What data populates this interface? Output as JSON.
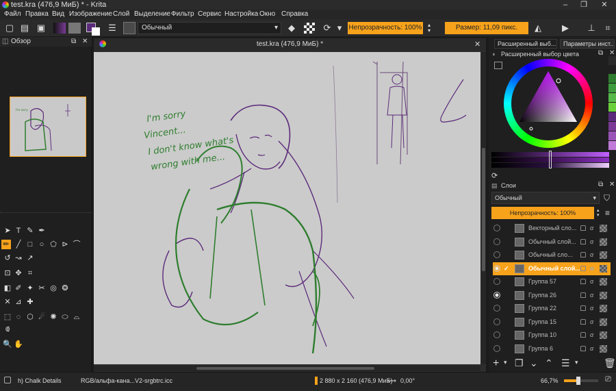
{
  "window": {
    "title": "test.kra (476,9 МиБ) * - Krita"
  },
  "menu": [
    "Файл",
    "Правка",
    "Вид",
    "Изображение",
    "Слой",
    "Выделение",
    "Фильтр",
    "Сервис",
    "Настройка",
    "Окно",
    "Справка"
  ],
  "toolbar": {
    "blend_mode": "Обычный",
    "opacity_label": "Непрозрачность: 100%",
    "size_label": "Размер: 11,09 пикс."
  },
  "overview": {
    "title": "Обзор"
  },
  "canvas": {
    "tab_title": "test.kra (476,9 МиБ) *",
    "handwriting": [
      "I'm sorry",
      "Vincent...",
      "I don't know what's",
      "wrong with me..."
    ]
  },
  "right_tabs": [
    "Расширенный выб...",
    "Параметры инст..."
  ],
  "color_selector": {
    "title": "Расширенный выбор цвета"
  },
  "layers": {
    "title": "Слои",
    "blend_mode": "Обычный",
    "opacity_label": "Непрозрачность: 100%",
    "items": [
      {
        "name": "Векторный сло...",
        "visible": false,
        "active": false
      },
      {
        "name": "Обычный слой...",
        "visible": false,
        "active": false
      },
      {
        "name": "Обычный сло...",
        "visible": false,
        "active": false
      },
      {
        "name": "Обычный слой...",
        "visible": true,
        "active": true
      },
      {
        "name": "Группа 57",
        "visible": false,
        "active": false
      },
      {
        "name": "Группа 26",
        "visible": true,
        "active": false
      },
      {
        "name": "Группа 22",
        "visible": false,
        "active": false
      },
      {
        "name": "Группа 15",
        "visible": false,
        "active": false
      },
      {
        "name": "Группа 10",
        "visible": false,
        "active": false
      },
      {
        "name": "Группа 6",
        "visible": false,
        "active": false
      }
    ]
  },
  "status": {
    "brush": "h) Chalk Details",
    "color_space": "RGB/альфа-кана...V2-srgbtrc.icc",
    "image_size": "2 880 x 2 160 (476,9 МиБ)",
    "rotation": "0,00°",
    "zoom": "66,7%"
  },
  "colors": {
    "accent": "#f7a21b",
    "sketch_purple": "#5b2a7a",
    "sketch_green": "#2e7d2e",
    "background": "#1f1f1f"
  }
}
